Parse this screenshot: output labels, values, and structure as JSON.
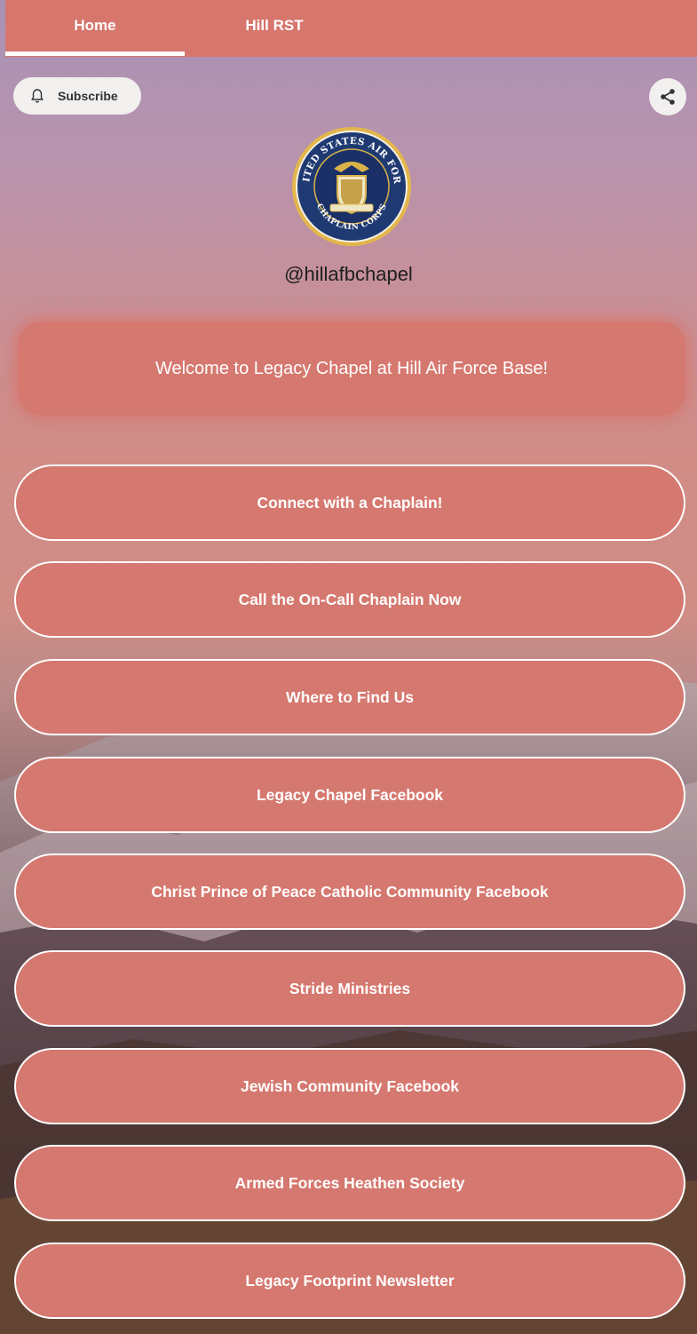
{
  "tabs": [
    {
      "label": "Home",
      "active": true
    },
    {
      "label": "Hill RST",
      "active": false
    }
  ],
  "subscribe": {
    "label": "Subscribe",
    "icon": "bell-icon"
  },
  "share": {
    "icon": "share-icon"
  },
  "profile": {
    "handle": "@hillafbchapel",
    "logo_text_top": "UNITED STATES AIR FORCE",
    "logo_text_bottom": "CHAPLAIN CORPS"
  },
  "welcome_text": "Welcome to Legacy Chapel at Hill Air Force Base!",
  "links": [
    {
      "label": "Connect with a Chaplain!"
    },
    {
      "label": "Call the On-Call Chaplain Now"
    },
    {
      "label": "Where to Find Us"
    },
    {
      "label": "Legacy Chapel Facebook"
    },
    {
      "label": "Christ Prince of Peace Catholic Community Facebook"
    },
    {
      "label": "Stride Ministries"
    },
    {
      "label": "Jewish Community Facebook"
    },
    {
      "label": "Armed Forces Heathen Society"
    },
    {
      "label": "Legacy Footprint Newsletter"
    }
  ],
  "colors": {
    "accent": "#d6766d",
    "button_fill": "#d5786f",
    "button_border": "#ffffff"
  }
}
